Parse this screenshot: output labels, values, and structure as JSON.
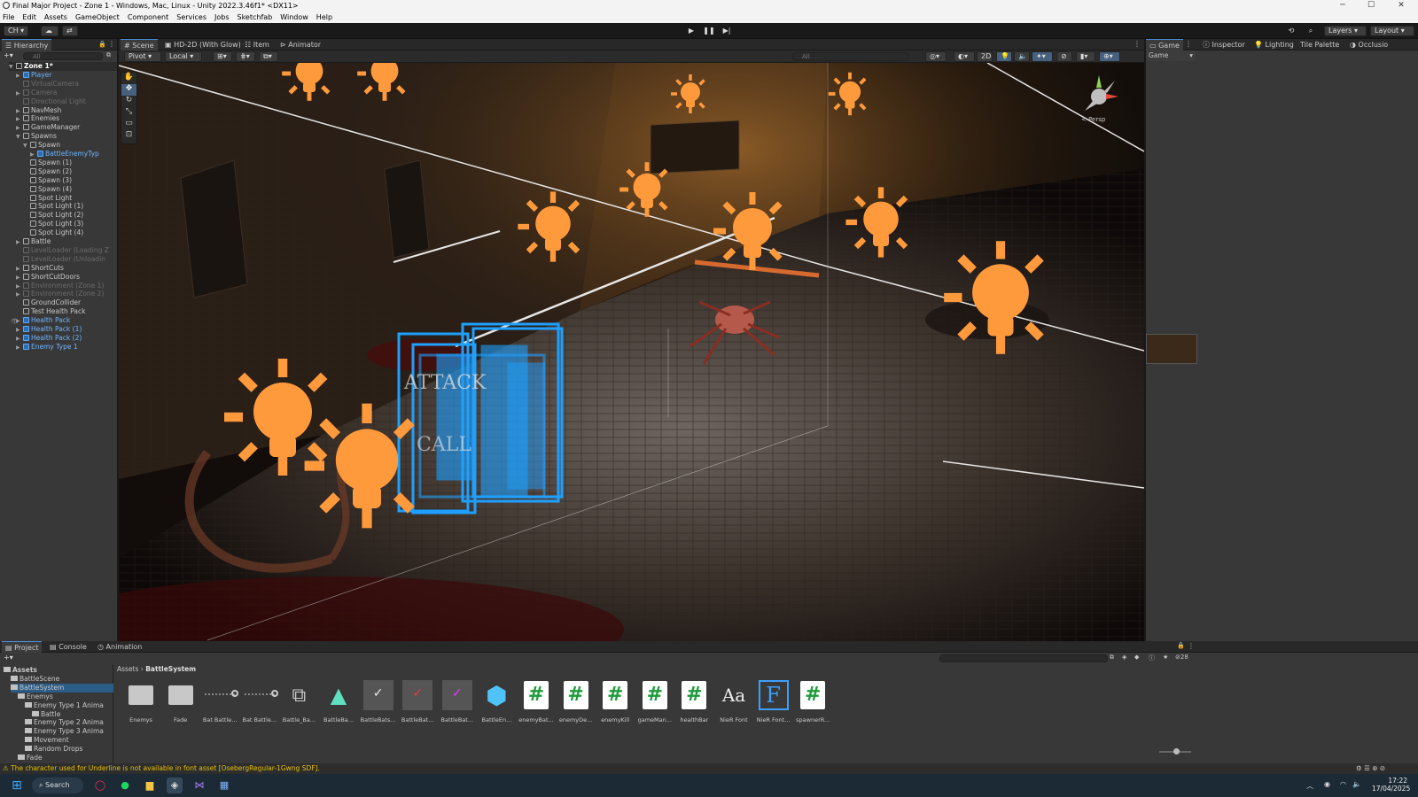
{
  "window": {
    "title": "Final Major Project - Zone 1 - Windows, Mac, Linux - Unity 2022.3.46f1* <DX11>",
    "minimize": "─",
    "maximize": "☐",
    "close": "✕"
  },
  "menu": [
    "File",
    "Edit",
    "Assets",
    "GameObject",
    "Component",
    "Services",
    "Jobs",
    "Sketchfab",
    "Window",
    "Help"
  ],
  "toolbar": {
    "account": "CH ▾",
    "play": "▶",
    "pause": "❚❚",
    "step": "▶|",
    "layers": "Layers",
    "layout": "Layout"
  },
  "hierarchy": {
    "tab": "Hierarchy",
    "search_placeholder": "All",
    "scene_root": "Zone 1*",
    "items": [
      {
        "label": "Player",
        "style": "blue",
        "indent": 1
      },
      {
        "label": "VirtualCamera",
        "style": "dim",
        "indent": 1
      },
      {
        "label": "Camera",
        "style": "dim",
        "indent": 1
      },
      {
        "label": "Directional Light",
        "style": "dim",
        "indent": 1
      },
      {
        "label": "NavMesh",
        "style": "normal",
        "indent": 1
      },
      {
        "label": "Enemies",
        "style": "normal",
        "indent": 1
      },
      {
        "label": "GameManager",
        "style": "normal",
        "indent": 1
      },
      {
        "label": "Spawns",
        "style": "normal",
        "indent": 1
      },
      {
        "label": "Spawn",
        "style": "normal",
        "indent": 2
      },
      {
        "label": "BattleEnemyTyp",
        "style": "blue",
        "indent": 3
      },
      {
        "label": "Spawn (1)",
        "style": "normal",
        "indent": 2
      },
      {
        "label": "Spawn (2)",
        "style": "normal",
        "indent": 2
      },
      {
        "label": "Spawn (3)",
        "style": "normal",
        "indent": 2
      },
      {
        "label": "Spawn (4)",
        "style": "normal",
        "indent": 2
      },
      {
        "label": "Spot Light",
        "style": "normal",
        "indent": 2
      },
      {
        "label": "Spot Light (1)",
        "style": "normal",
        "indent": 2
      },
      {
        "label": "Spot Light (2)",
        "style": "normal",
        "indent": 2
      },
      {
        "label": "Spot Light (3)",
        "style": "normal",
        "indent": 2
      },
      {
        "label": "Spot Light (4)",
        "style": "normal",
        "indent": 2
      },
      {
        "label": "Battle",
        "style": "normal",
        "indent": 1
      },
      {
        "label": "LevelLoader (Loading Z",
        "style": "dim",
        "indent": 1
      },
      {
        "label": "LevelLoader (Unloadin",
        "style": "dim",
        "indent": 1
      },
      {
        "label": "ShortCuts",
        "style": "normal",
        "indent": 1
      },
      {
        "label": "ShortCutDoors",
        "style": "normal",
        "indent": 1
      },
      {
        "label": "Environment (Zone 1)",
        "style": "dim",
        "indent": 1
      },
      {
        "label": "Environment (Zone 2)",
        "style": "dim",
        "indent": 1
      },
      {
        "label": "GroundCollider",
        "style": "normal",
        "indent": 1
      },
      {
        "label": "Test Health Pack",
        "style": "normal",
        "indent": 1
      },
      {
        "label": "Health Pack",
        "style": "blue",
        "indent": 1
      },
      {
        "label": "Health Pack (1)",
        "style": "blue",
        "indent": 1
      },
      {
        "label": "Health Pack (2)",
        "style": "blue",
        "indent": 1
      },
      {
        "label": "Enemy Type 1",
        "style": "blue",
        "indent": 1
      }
    ]
  },
  "scene_tabs": [
    "Scene",
    "HD-2D (With Glow)",
    "Item",
    "Animator"
  ],
  "scene_toolbar": {
    "pivot": "Pivot",
    "local": "Local",
    "search_placeholder": "All",
    "mode_2d": "2D",
    "persp": "< Persp"
  },
  "right_tabs": {
    "game": "Game",
    "game_display": "Game",
    "inspector": "Inspector",
    "lighting": "Lighting",
    "tile_palette": "Tile Palette",
    "occlusion": "Occlusio"
  },
  "project": {
    "tabs": [
      "Project",
      "Console",
      "Animation"
    ],
    "breadcrumb_root": "Assets",
    "breadcrumb_current": "BattleSystem",
    "badge_count": "28",
    "tree": [
      {
        "label": "Assets",
        "indent": 0,
        "bold": true
      },
      {
        "label": "BattleScene",
        "indent": 1
      },
      {
        "label": "BattleSystem",
        "indent": 1,
        "selected": true
      },
      {
        "label": "Enemys",
        "indent": 2
      },
      {
        "label": "Enemy Type 1 Anima",
        "indent": 3
      },
      {
        "label": "Battle",
        "indent": 4
      },
      {
        "label": "Enemy Type 2 Anima",
        "indent": 3
      },
      {
        "label": "Enemy Type 3 Anima",
        "indent": 3
      },
      {
        "label": "Movement",
        "indent": 3
      },
      {
        "label": "Random Drops",
        "indent": 3
      },
      {
        "label": "Fade",
        "indent": 2
      }
    ],
    "assets": [
      {
        "label": "Enemys",
        "kind": "folder"
      },
      {
        "label": "Fade",
        "kind": "folder"
      },
      {
        "label": "Bat Battle...",
        "kind": "anim"
      },
      {
        "label": "Bat Battle...",
        "kind": "anim"
      },
      {
        "label": "Battle_Ba...",
        "kind": "controller"
      },
      {
        "label": "BattleBa...",
        "kind": "shader"
      },
      {
        "label": "BattleBats...",
        "kind": "mark-white"
      },
      {
        "label": "BattleBat...",
        "kind": "mark-red"
      },
      {
        "label": "BattleBat...",
        "kind": "mark-pink"
      },
      {
        "label": "BattleEn...",
        "kind": "cube"
      },
      {
        "label": "enemyBat...",
        "kind": "script"
      },
      {
        "label": "enemyDe...",
        "kind": "script"
      },
      {
        "label": "enemyKill",
        "kind": "script"
      },
      {
        "label": "gameMan...",
        "kind": "script"
      },
      {
        "label": "healthBar",
        "kind": "script"
      },
      {
        "label": "NieR Font",
        "kind": "font"
      },
      {
        "label": "NieR Font...",
        "kind": "fontasset"
      },
      {
        "label": "spawnerR...",
        "kind": "script"
      }
    ]
  },
  "status": {
    "message": "The character used for Underline is not available in font asset [OsebergRegular-1Gwng SDF]."
  },
  "taskbar": {
    "search": "Search",
    "time": "17:22",
    "date": "17/04/2025"
  },
  "colors": {
    "accent": "#4d8ed9",
    "prefab_blue": "#6fb6ff",
    "light_gizmo": "#ff9a3c",
    "ui_gizmo": "#1ea0ff",
    "warning": "#e8c000"
  }
}
